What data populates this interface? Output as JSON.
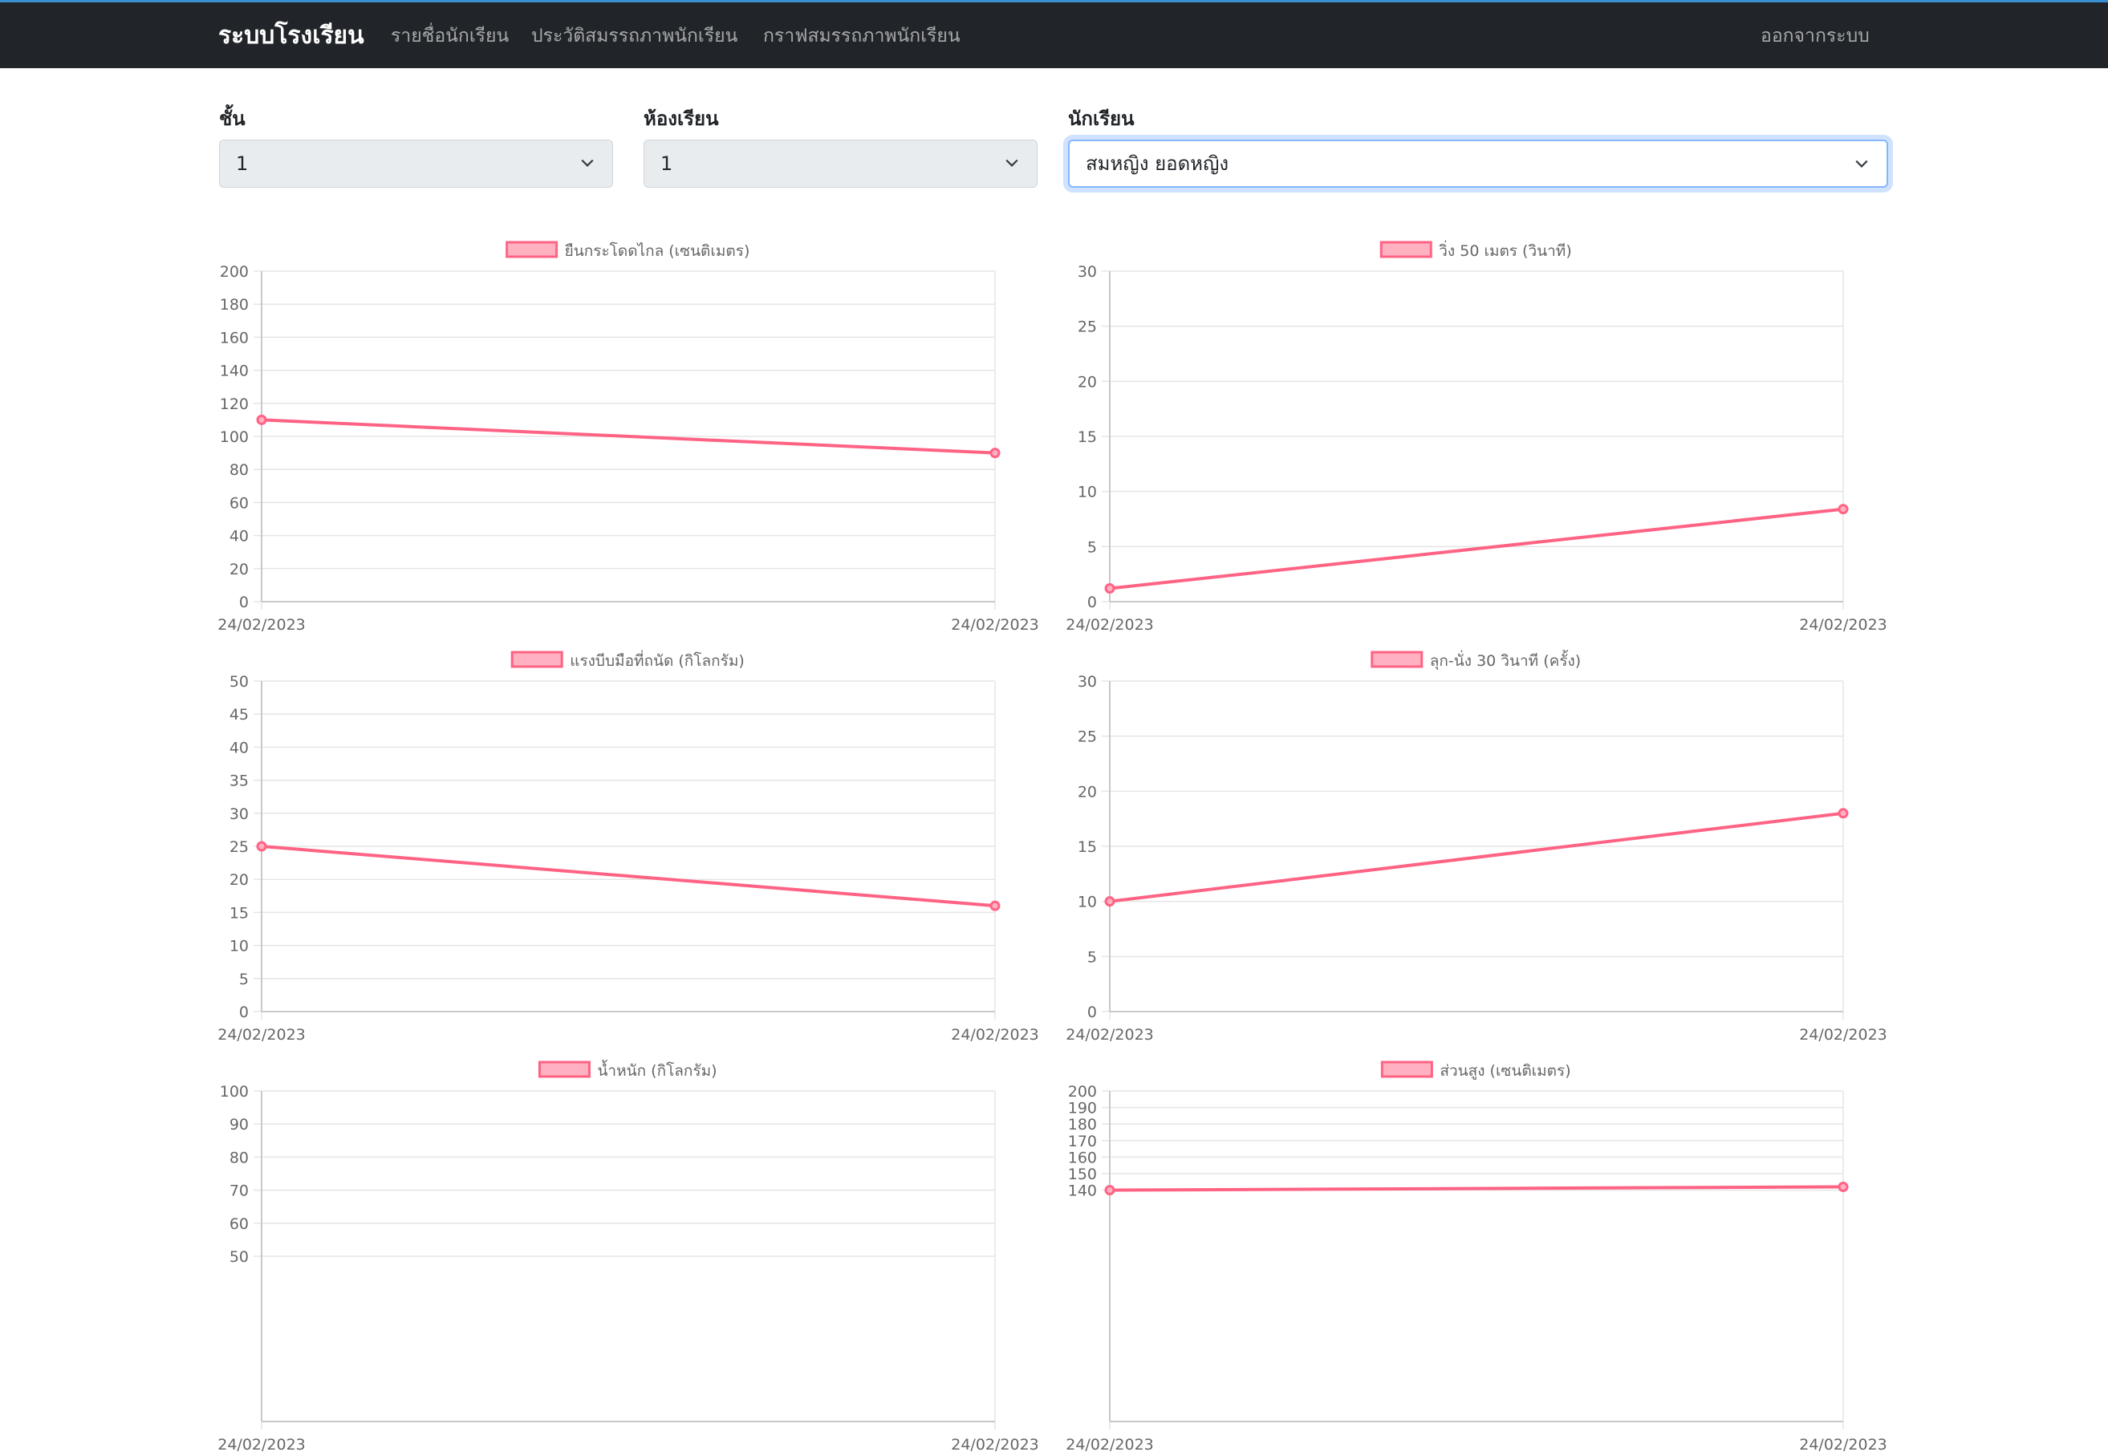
{
  "navbar": {
    "brand": "ระบบโรงเรียน",
    "links": [
      "รายชื่อนักเรียน",
      "ประวัติสมรรถภาพนักเรียน",
      "กราฟสมรรถภาพนักเรียน"
    ],
    "logout": "ออกจากระบบ"
  },
  "filters": {
    "grade": {
      "label": "ชั้น",
      "value": "1"
    },
    "room": {
      "label": "ห้องเรียน",
      "value": "1"
    },
    "student": {
      "label": "นักเรียน",
      "value": "สมหญิง ยอดหญิง"
    }
  },
  "colors": {
    "line": "#ff6384",
    "legend_fill": "#ffb1c1",
    "grid": "#e5e5e5",
    "tick": "#666666"
  },
  "chart_data": [
    {
      "type": "line",
      "title": "",
      "categories": [
        "24/02/2023",
        "24/02/2023"
      ],
      "series": [
        {
          "name": "ยืนกระโดดไกล (เซนติเมตร)",
          "values": [
            110,
            90
          ]
        }
      ],
      "ylim": [
        0,
        200
      ],
      "yticks": [
        0,
        20,
        40,
        60,
        80,
        100,
        120,
        140,
        160,
        180,
        200
      ],
      "grid": true,
      "legend": "top"
    },
    {
      "type": "line",
      "title": "",
      "categories": [
        "24/02/2023",
        "24/02/2023"
      ],
      "series": [
        {
          "name": "วิ่ง 50 เมตร (วินาที)",
          "values": [
            1.2,
            8.4
          ]
        }
      ],
      "ylim": [
        0,
        30
      ],
      "yticks": [
        0,
        5,
        10,
        15,
        20,
        25,
        30
      ],
      "grid": true,
      "legend": "top"
    },
    {
      "type": "line",
      "title": "",
      "categories": [
        "24/02/2023",
        "24/02/2023"
      ],
      "series": [
        {
          "name": "แรงบีบมือที่ถนัด (กิโลกรัม)",
          "values": [
            25,
            16
          ]
        }
      ],
      "ylim": [
        0,
        50
      ],
      "yticks": [
        0,
        5,
        10,
        15,
        20,
        25,
        30,
        35,
        40,
        45,
        50
      ],
      "grid": true,
      "legend": "top"
    },
    {
      "type": "line",
      "title": "",
      "categories": [
        "24/02/2023",
        "24/02/2023"
      ],
      "series": [
        {
          "name": "ลุก-นั่ง 30 วินาที (ครั้ง)",
          "values": [
            10,
            18
          ]
        }
      ],
      "ylim": [
        0,
        30
      ],
      "yticks": [
        0,
        5,
        10,
        15,
        20,
        25,
        30
      ],
      "grid": true,
      "legend": "top"
    },
    {
      "type": "line",
      "title": "",
      "categories": [
        "24/02/2023",
        "24/02/2023"
      ],
      "series": [
        {
          "name": "น้ำหนัก (กิโลกรัม)",
          "values": []
        }
      ],
      "ylim": [
        0,
        100
      ],
      "yticks": [
        50,
        60,
        70,
        80,
        90,
        100
      ],
      "grid": true,
      "legend": "top"
    },
    {
      "type": "line",
      "title": "",
      "categories": [
        "24/02/2023",
        "24/02/2023"
      ],
      "series": [
        {
          "name": "ส่วนสูง (เซนติเมตร)",
          "values": [
            140,
            142
          ]
        }
      ],
      "ylim": [
        0,
        200
      ],
      "yticks": [
        140,
        150,
        160,
        170,
        180,
        190,
        200
      ],
      "grid": true,
      "legend": "top"
    }
  ]
}
